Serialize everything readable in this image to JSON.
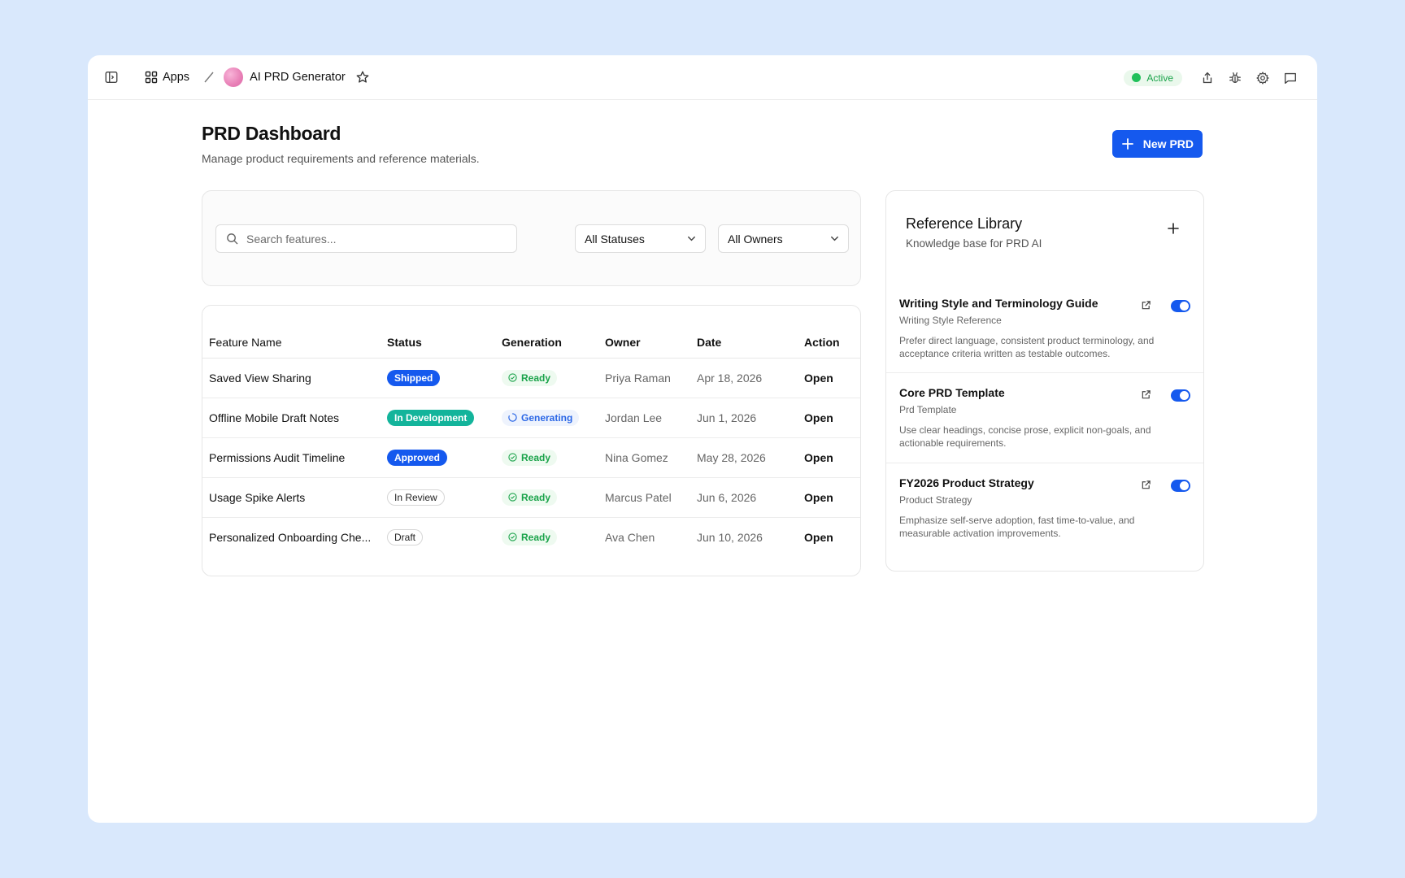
{
  "topbar": {
    "apps_label": "Apps",
    "app_name": "AI PRD Generator",
    "status_label": "Active",
    "status_color": "#20c05a"
  },
  "header": {
    "title": "PRD Dashboard",
    "subtitle": "Manage product requirements and reference materials.",
    "new_button_label": "New PRD"
  },
  "filters": {
    "search_placeholder": "Search features...",
    "status_select": "All Statuses",
    "owner_select": "All Owners"
  },
  "table": {
    "columns": [
      "Feature Name",
      "Status",
      "Generation",
      "Owner",
      "Date",
      "Action"
    ],
    "rows": [
      {
        "name": "Saved View Sharing",
        "status": "Shipped",
        "generation": "Ready",
        "owner": "Priya Raman",
        "date": "Apr 18, 2026",
        "action": "Open"
      },
      {
        "name": "Offline Mobile Draft Notes",
        "status": "In Development",
        "generation": "Generating",
        "owner": "Jordan Lee",
        "date": "Jun 1, 2026",
        "action": "Open"
      },
      {
        "name": "Permissions Audit Timeline",
        "status": "Approved",
        "generation": "Ready",
        "owner": "Nina Gomez",
        "date": "May 28, 2026",
        "action": "Open"
      },
      {
        "name": "Usage Spike Alerts",
        "status": "In Review",
        "generation": "Ready",
        "owner": "Marcus Patel",
        "date": "Jun 6, 2026",
        "action": "Open"
      },
      {
        "name": "Personalized Onboarding Che...",
        "status": "Draft",
        "generation": "Ready",
        "owner": "Ava Chen",
        "date": "Jun 10, 2026",
        "action": "Open"
      }
    ]
  },
  "library": {
    "title": "Reference Library",
    "subtitle": "Knowledge base for PRD AI",
    "items": [
      {
        "title": "Writing Style and Terminology Guide",
        "type": "Writing Style Reference",
        "description": "Prefer direct language, consistent product terminology, and acceptance criteria written as testable outcomes.",
        "enabled": true
      },
      {
        "title": "Core PRD Template",
        "type": "Prd Template",
        "description": "Use clear headings, concise prose, explicit non-goals, and actionable requirements.",
        "enabled": true
      },
      {
        "title": "FY2026 Product Strategy",
        "type": "Product Strategy",
        "description": "Emphasize self-serve adoption, fast time-to-value, and measurable activation improvements.",
        "enabled": true
      }
    ]
  },
  "colors": {
    "accent": "#1559ee",
    "teal": "#13b49b",
    "ready_green": "#1aa34a",
    "background": "#d9e8fc"
  }
}
